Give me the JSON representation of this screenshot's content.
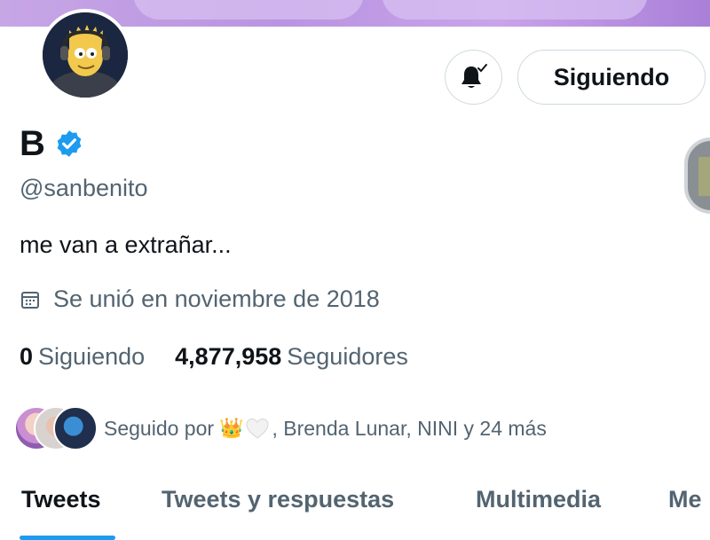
{
  "profile": {
    "display_name": "B",
    "handle": "@sanbenito",
    "bio": "me van a extrañar...",
    "joined": "Se unió en noviembre de 2018",
    "verified": true
  },
  "actions": {
    "follow_label": "Siguiendo",
    "notify_icon": "bell-check-icon"
  },
  "stats": {
    "following_count": "0",
    "following_label": "Siguiendo",
    "followers_count": "4,877,958",
    "followers_label": "Seguidores"
  },
  "followed_by": {
    "prefix": "Seguido por",
    "emoji": "👑",
    "rest": ", Brenda Lunar, NINI y 24 más"
  },
  "tabs": [
    {
      "label": "Tweets"
    },
    {
      "label": "Tweets y respuestas"
    },
    {
      "label": "Multimedia"
    },
    {
      "label": "Me"
    }
  ],
  "colors": {
    "accent": "#1d9bf0",
    "secondary_text": "#536471",
    "primary_text": "#0f1419"
  }
}
